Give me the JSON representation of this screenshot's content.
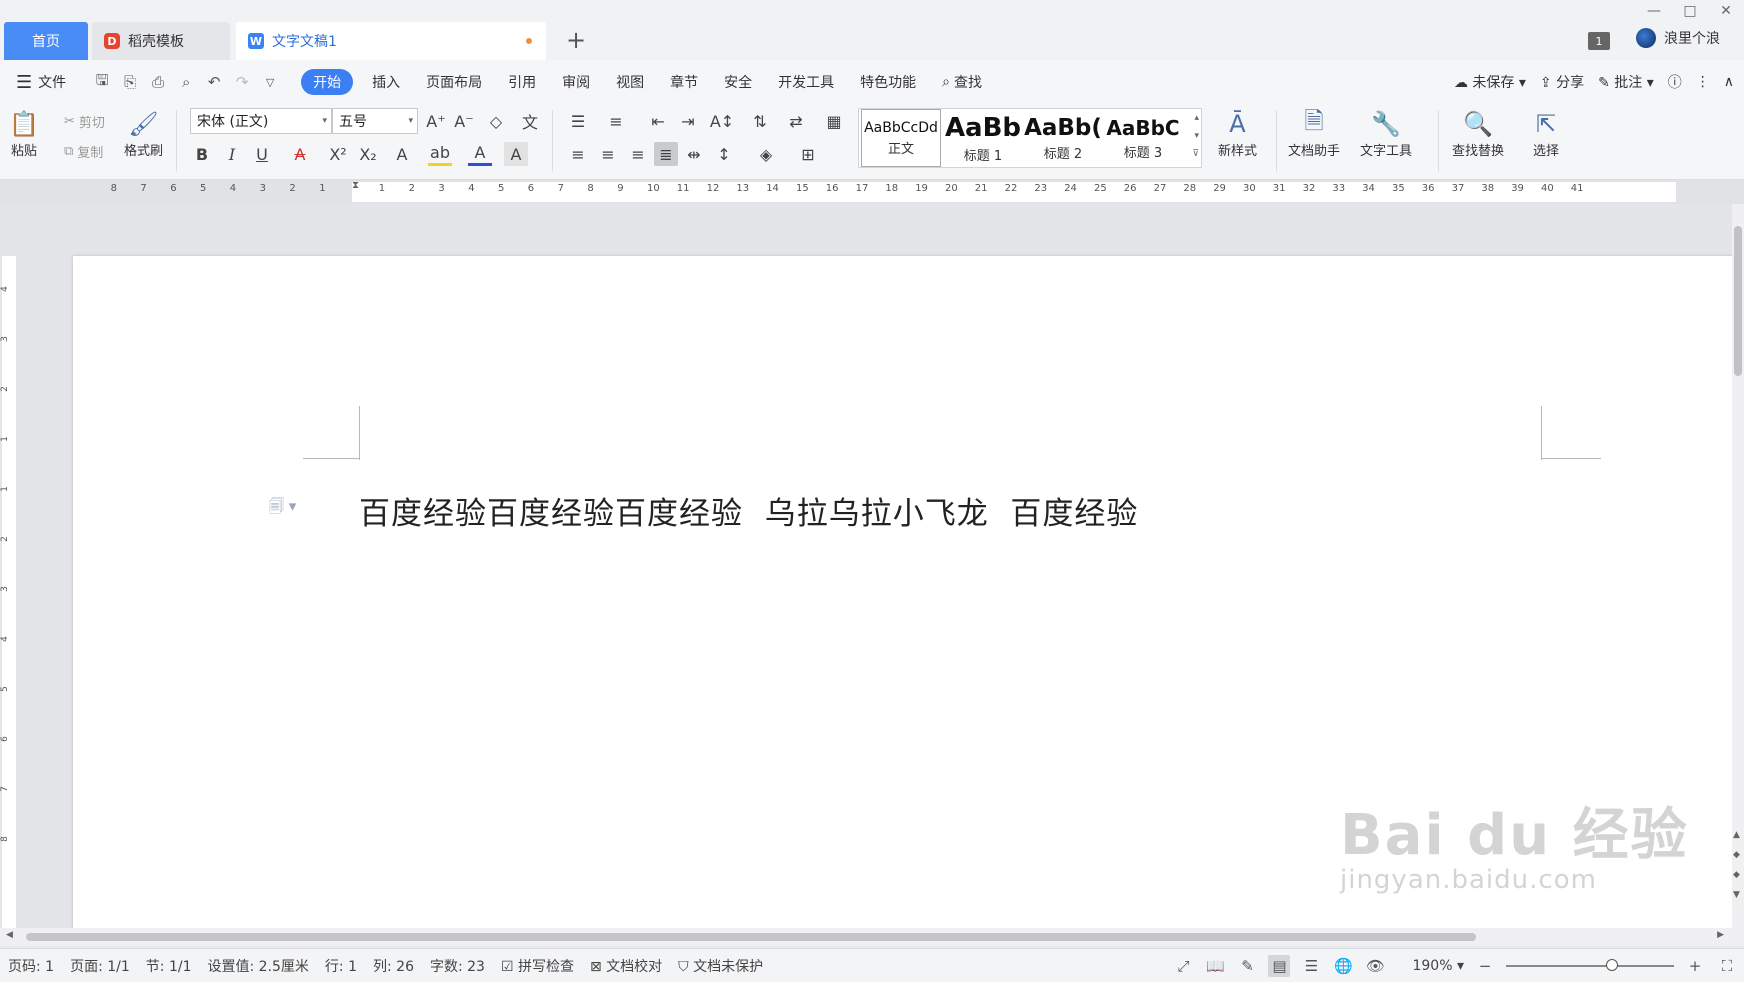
{
  "tabs": {
    "home": "首页",
    "template": "稻壳模板",
    "document": "文字文稿1",
    "add": "+"
  },
  "window": {
    "badge": "1",
    "user_name": "浪里个浪",
    "minimize": "—",
    "maximize": "□",
    "close": "✕"
  },
  "menu": {
    "file": "文件",
    "items": [
      "开始",
      "插入",
      "页面布局",
      "引用",
      "审阅",
      "视图",
      "章节",
      "安全",
      "开发工具",
      "特色功能"
    ],
    "search": "查找",
    "unsaved": "未保存",
    "share": "分享",
    "comment": "批注"
  },
  "ribbon": {
    "paste": "粘贴",
    "cut": "剪切",
    "copy": "复制",
    "format_painter": "格式刷",
    "font_name": "宋体 (正文)",
    "font_size": "五号",
    "styles": [
      {
        "preview": "AaBbCcDd",
        "name": "正文"
      },
      {
        "preview": "AaBb",
        "name": "标题 1"
      },
      {
        "preview": "AaBb(",
        "name": "标题 2"
      },
      {
        "preview": "AaBbC",
        "name": "标题 3"
      }
    ],
    "new_style": "新样式",
    "doc_assistant": "文档助手",
    "text_tools": "文字工具",
    "find_replace": "查找替换",
    "select": "选择"
  },
  "ruler": {
    "left_ticks": [
      "8",
      "7",
      "6",
      "5",
      "4",
      "3",
      "2",
      "1"
    ],
    "right_ticks": [
      "1",
      "2",
      "3",
      "4",
      "5",
      "6",
      "7",
      "8",
      "9",
      "10",
      "11",
      "12",
      "13",
      "14",
      "15",
      "16",
      "17",
      "18",
      "19",
      "20",
      "21",
      "22",
      "23",
      "24",
      "25",
      "26",
      "27",
      "28",
      "29",
      "30",
      "31",
      "32",
      "33",
      "34",
      "35",
      "36",
      "37",
      "38",
      "39",
      "40",
      "41"
    ],
    "vertical_ticks": [
      "4",
      "3",
      "2",
      "1",
      "1",
      "2",
      "3",
      "4",
      "5",
      "6",
      "7",
      "8"
    ]
  },
  "document": {
    "text": "百度经验百度经验百度经验  乌拉乌拉小飞龙  百度经验"
  },
  "status": {
    "page": "页码: 1",
    "pages": "页面: 1/1",
    "section": "节: 1/1",
    "setting": "设置值: 2.5厘米",
    "row": "行: 1",
    "col": "列: 26",
    "words": "字数: 23",
    "spell_check": "拼写检查",
    "doc_proof": "文档校对",
    "protect": "文档未保护",
    "zoom": "190%"
  },
  "watermark": {
    "brand": "Bai du 经验",
    "url": "jingyan.baidu.com"
  }
}
